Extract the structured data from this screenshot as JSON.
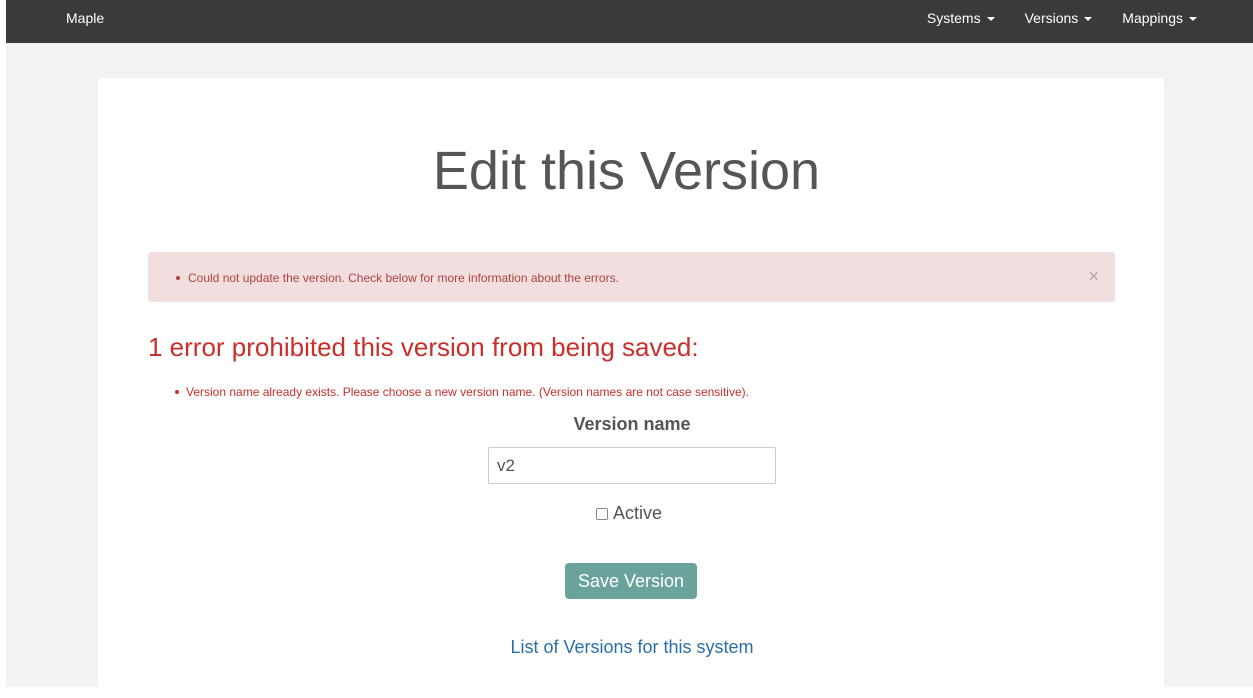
{
  "navbar": {
    "brand": "Maple",
    "menus": [
      {
        "label": "Systems"
      },
      {
        "label": "Versions"
      },
      {
        "label": "Mappings"
      }
    ]
  },
  "page": {
    "title": "Edit this Version"
  },
  "alert": {
    "message": "Could not update the version. Check below for more information about the errors.",
    "close_symbol": "×"
  },
  "errors": {
    "heading": "1 error prohibited this version from being saved:",
    "items": [
      "Version name already exists. Please choose a new version name. (Version names are not case sensitive)."
    ]
  },
  "form": {
    "version_name_label": "Version name",
    "version_name_value": "v2",
    "active_label": "Active",
    "active_checked": false,
    "save_label": "Save Version"
  },
  "links": {
    "back_label": "List of Versions for this system"
  },
  "colors": {
    "navbar": "#3a3a3a",
    "alert_bg": "#f2dede",
    "error_text": "#c9302c",
    "button": "#6aa39c",
    "link": "#2a6fa8"
  }
}
